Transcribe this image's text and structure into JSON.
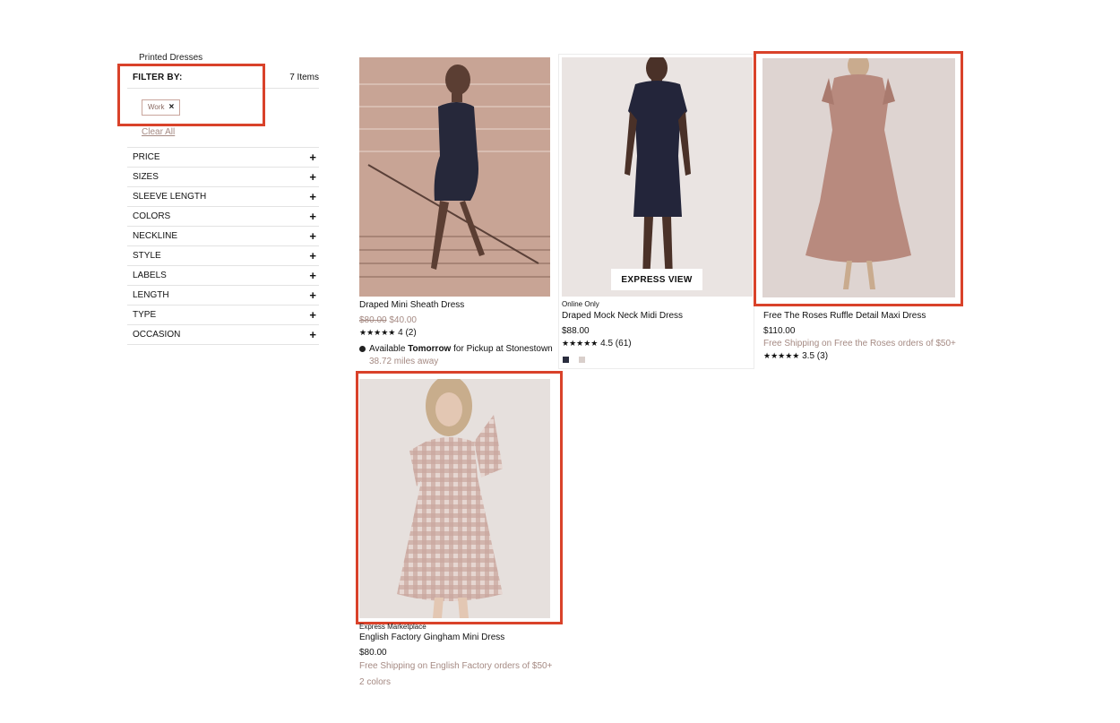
{
  "breadcrumb": "Printed Dresses",
  "filter": {
    "title": "FILTER BY:",
    "count": "7 Items",
    "active_chip": "Work",
    "chip_close": "×",
    "clear_all": "Clear All"
  },
  "facets": [
    {
      "label": "PRICE",
      "icon": "+"
    },
    {
      "label": "SIZES",
      "icon": "+"
    },
    {
      "label": "SLEEVE LENGTH",
      "icon": "+"
    },
    {
      "label": "COLORS",
      "icon": "+"
    },
    {
      "label": "NECKLINE",
      "icon": "+"
    },
    {
      "label": "STYLE",
      "icon": "+"
    },
    {
      "label": "LABELS",
      "icon": "+"
    },
    {
      "label": "LENGTH",
      "icon": "+"
    },
    {
      "label": "TYPE",
      "icon": "+"
    },
    {
      "label": "OCCASION",
      "icon": "+"
    }
  ],
  "products": [
    {
      "name": "Draped Mini Sheath Dress",
      "original_price": "$80.00",
      "price": "$40.00",
      "stars": "★★★★★",
      "rating": "4 (2)",
      "pickup_prefix": "Available ",
      "pickup_bold": "Tomorrow",
      "pickup_suffix": " for Pickup at Stonestown",
      "distance": "38.72 miles away"
    },
    {
      "badge": "Online Only",
      "name": "Draped Mock Neck Midi Dress",
      "price": "$88.00",
      "stars": "★★★★★",
      "rating": "4.5 (61)",
      "express_view": "EXPRESS VIEW",
      "swatch_colors": [
        "#2a2d3e",
        "#d9cfcb"
      ]
    },
    {
      "name": "Free The Roses Ruffle Detail Maxi Dress",
      "price": "$110.00",
      "shipping": "Free Shipping on Free the Roses orders of $50+",
      "stars": "★★★★★",
      "rating": "3.5 (3)"
    },
    {
      "badge": "Express Marketplace",
      "name": "English Factory Gingham Mini Dress",
      "price": "$80.00",
      "shipping": "Free Shipping on English Factory orders of $50+",
      "colors_count": "2 colors"
    }
  ],
  "colors": {
    "highlight": "#d9422a",
    "muted_text": "#a58a83"
  }
}
